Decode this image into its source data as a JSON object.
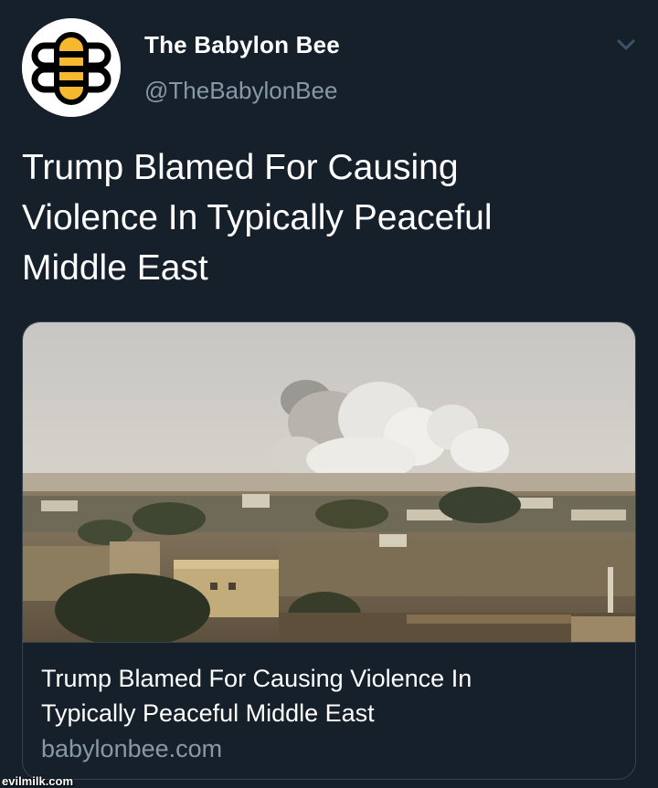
{
  "account": {
    "display_name": "The Babylon Bee",
    "handle": "@TheBabylonBee",
    "avatar_icon": "bee-logo-icon",
    "menu_icon": "chevron-down-icon"
  },
  "tweet": {
    "text": "Trump Blamed For Causing\nViolence In Typically Peaceful\nMiddle East"
  },
  "link_card": {
    "image_description_icon": "photo",
    "title": "Trump Blamed For Causing Violence In\nTypically Peaceful Middle East",
    "domain": "babylonbee.com"
  },
  "watermark": "evilmilk.com",
  "colors": {
    "background": "#15202b",
    "secondary_text": "#8899a6",
    "border": "#38444d",
    "bee_yellow": "#f5b82e"
  }
}
